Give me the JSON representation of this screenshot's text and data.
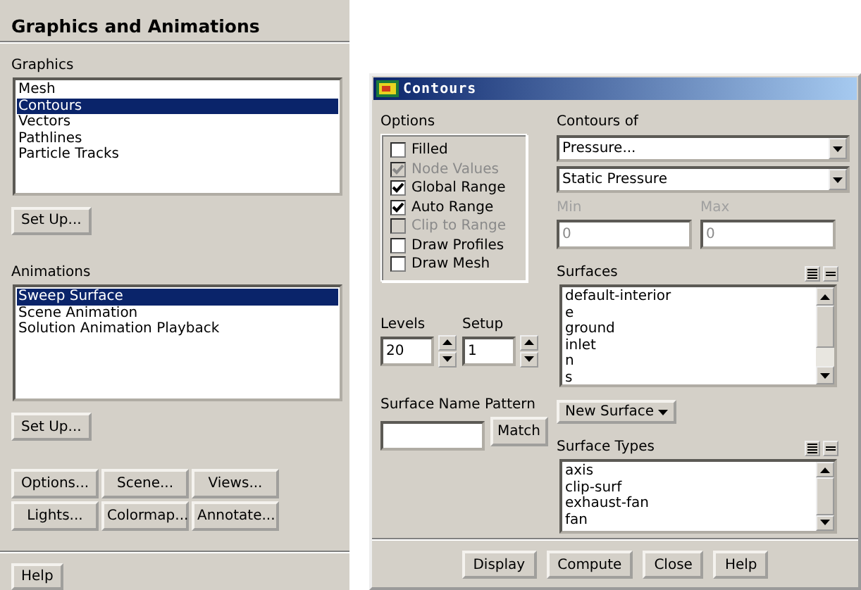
{
  "panel": {
    "title": "Graphics and Animations",
    "graphics": {
      "label": "Graphics",
      "items": [
        {
          "label": "Mesh",
          "selected": false
        },
        {
          "label": "Contours",
          "selected": true
        },
        {
          "label": "Vectors",
          "selected": false
        },
        {
          "label": "Pathlines",
          "selected": false
        },
        {
          "label": "Particle Tracks",
          "selected": false
        }
      ],
      "button": "Set Up..."
    },
    "animations": {
      "label": "Animations",
      "items": [
        {
          "label": "Sweep Surface",
          "selected": true
        },
        {
          "label": "Scene Animation",
          "selected": false
        },
        {
          "label": "Solution Animation Playback",
          "selected": false
        }
      ],
      "button": "Set Up..."
    },
    "buttons": [
      "Options...",
      "Scene...",
      "Views...",
      "Lights...",
      "Colormap...",
      "Annotate..."
    ],
    "help": "Help"
  },
  "dialog": {
    "title": "Contours",
    "options": {
      "label": "Options",
      "items": [
        {
          "label": "Filled",
          "checked": false,
          "disabled": false
        },
        {
          "label": "Node Values",
          "checked": true,
          "disabled": true
        },
        {
          "label": "Global Range",
          "checked": true,
          "disabled": false
        },
        {
          "label": "Auto Range",
          "checked": true,
          "disabled": false
        },
        {
          "label": "Clip to Range",
          "checked": false,
          "disabled": true
        },
        {
          "label": "Draw Profiles",
          "checked": false,
          "disabled": false
        },
        {
          "label": "Draw Mesh",
          "checked": false,
          "disabled": false
        }
      ]
    },
    "levels": {
      "label": "Levels",
      "value": "20"
    },
    "setup": {
      "label": "Setup",
      "value": "1"
    },
    "pattern": {
      "label": "Surface Name Pattern",
      "button": "Match"
    },
    "contours_of": {
      "label": "Contours of",
      "value": "Pressure...",
      "sub_value": "Static Pressure"
    },
    "min": {
      "label": "Min",
      "value": "0",
      "disabled": true
    },
    "max": {
      "label": "Max",
      "value": "0",
      "disabled": true
    },
    "surfaces": {
      "label": "Surfaces",
      "items": [
        {
          "label": "default-interior",
          "selected": false
        },
        {
          "label": "e",
          "selected": false
        },
        {
          "label": "ground",
          "selected": false
        },
        {
          "label": "inlet",
          "selected": false
        },
        {
          "label": "n",
          "selected": false
        },
        {
          "label": "s",
          "selected": false
        }
      ]
    },
    "new_surface": "New Surface",
    "surface_types": {
      "label": "Surface Types",
      "items": [
        {
          "label": "axis",
          "selected": false
        },
        {
          "label": "clip-surf",
          "selected": false
        },
        {
          "label": "exhaust-fan",
          "selected": false
        },
        {
          "label": "fan",
          "selected": false
        }
      ]
    },
    "buttons": [
      "Display",
      "Compute",
      "Close",
      "Help"
    ]
  }
}
